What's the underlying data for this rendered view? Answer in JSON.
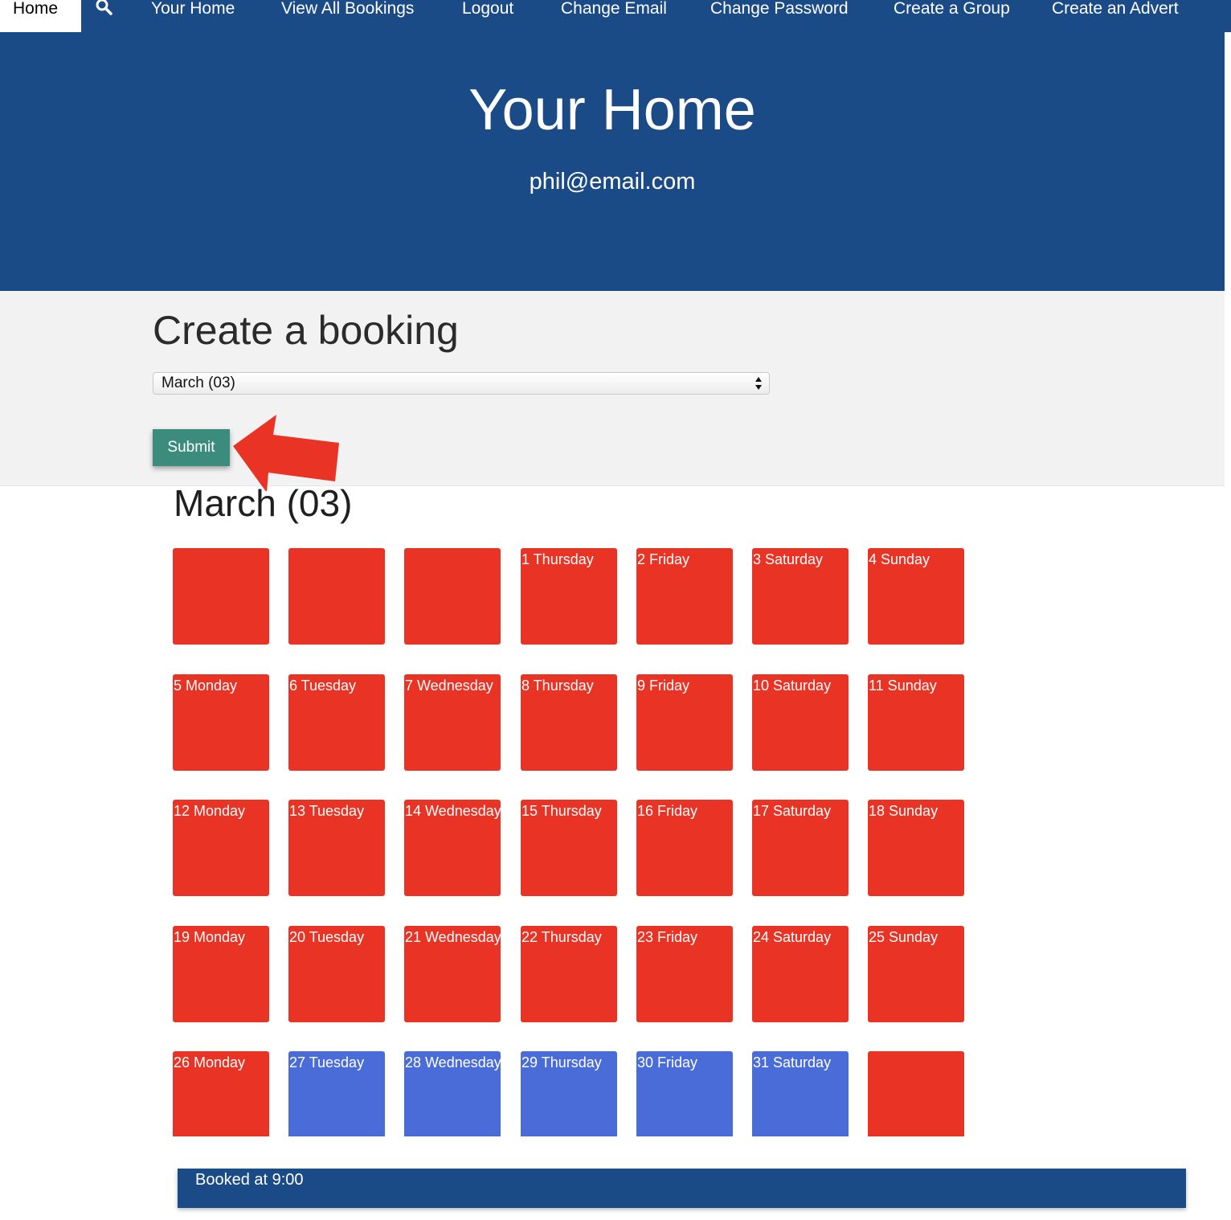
{
  "nav": {
    "home": "Home",
    "items": [
      "Your Home",
      "View All Bookings",
      "Logout",
      "Change Email",
      "Change Password",
      "Create a Group",
      "Create an Advert"
    ]
  },
  "hero": {
    "title": "Your Home",
    "email": "phil@email.com"
  },
  "booking": {
    "heading": "Create a booking",
    "selected_month": "March (03)",
    "submit_label": "Submit"
  },
  "calendar": {
    "month_title": "March (03)",
    "days": [
      {
        "label": "",
        "status": "red"
      },
      {
        "label": "",
        "status": "red"
      },
      {
        "label": "",
        "status": "red"
      },
      {
        "label": "1 Thursday",
        "status": "red"
      },
      {
        "label": "2 Friday",
        "status": "red"
      },
      {
        "label": "3 Saturday",
        "status": "red"
      },
      {
        "label": "4 Sunday",
        "status": "red"
      },
      {
        "label": "5 Monday",
        "status": "red"
      },
      {
        "label": "6 Tuesday",
        "status": "red"
      },
      {
        "label": "7 Wednesday",
        "status": "red"
      },
      {
        "label": "8 Thursday",
        "status": "red"
      },
      {
        "label": "9 Friday",
        "status": "red"
      },
      {
        "label": "10 Saturday",
        "status": "red"
      },
      {
        "label": "11 Sunday",
        "status": "red"
      },
      {
        "label": "12 Monday",
        "status": "red"
      },
      {
        "label": "13 Tuesday",
        "status": "red"
      },
      {
        "label": "14 Wednesday",
        "status": "red"
      },
      {
        "label": "15 Thursday",
        "status": "red"
      },
      {
        "label": "16 Friday",
        "status": "red"
      },
      {
        "label": "17 Saturday",
        "status": "red"
      },
      {
        "label": "18 Sunday",
        "status": "red"
      },
      {
        "label": "19 Monday",
        "status": "red"
      },
      {
        "label": "20 Tuesday",
        "status": "red"
      },
      {
        "label": "21 Wednesday",
        "status": "red"
      },
      {
        "label": "22 Thursday",
        "status": "red"
      },
      {
        "label": "23 Friday",
        "status": "red"
      },
      {
        "label": "24 Saturday",
        "status": "red"
      },
      {
        "label": "25 Sunday",
        "status": "red"
      },
      {
        "label": "26 Monday",
        "status": "red"
      },
      {
        "label": "27 Tuesday",
        "status": "blue"
      },
      {
        "label": "28 Wednesday",
        "status": "blue"
      },
      {
        "label": "29 Thursday",
        "status": "blue"
      },
      {
        "label": "30 Friday",
        "status": "blue"
      },
      {
        "label": "31 Saturday",
        "status": "blue"
      },
      {
        "label": "",
        "status": "red"
      }
    ]
  },
  "booked_text": "Booked at 9:00",
  "colors": {
    "nav_blue": "#1b4b87",
    "day_red": "#e93425",
    "day_blue": "#4a6cd8",
    "submit_green": "#3c8c7e",
    "arrow_red": "#e93425"
  }
}
